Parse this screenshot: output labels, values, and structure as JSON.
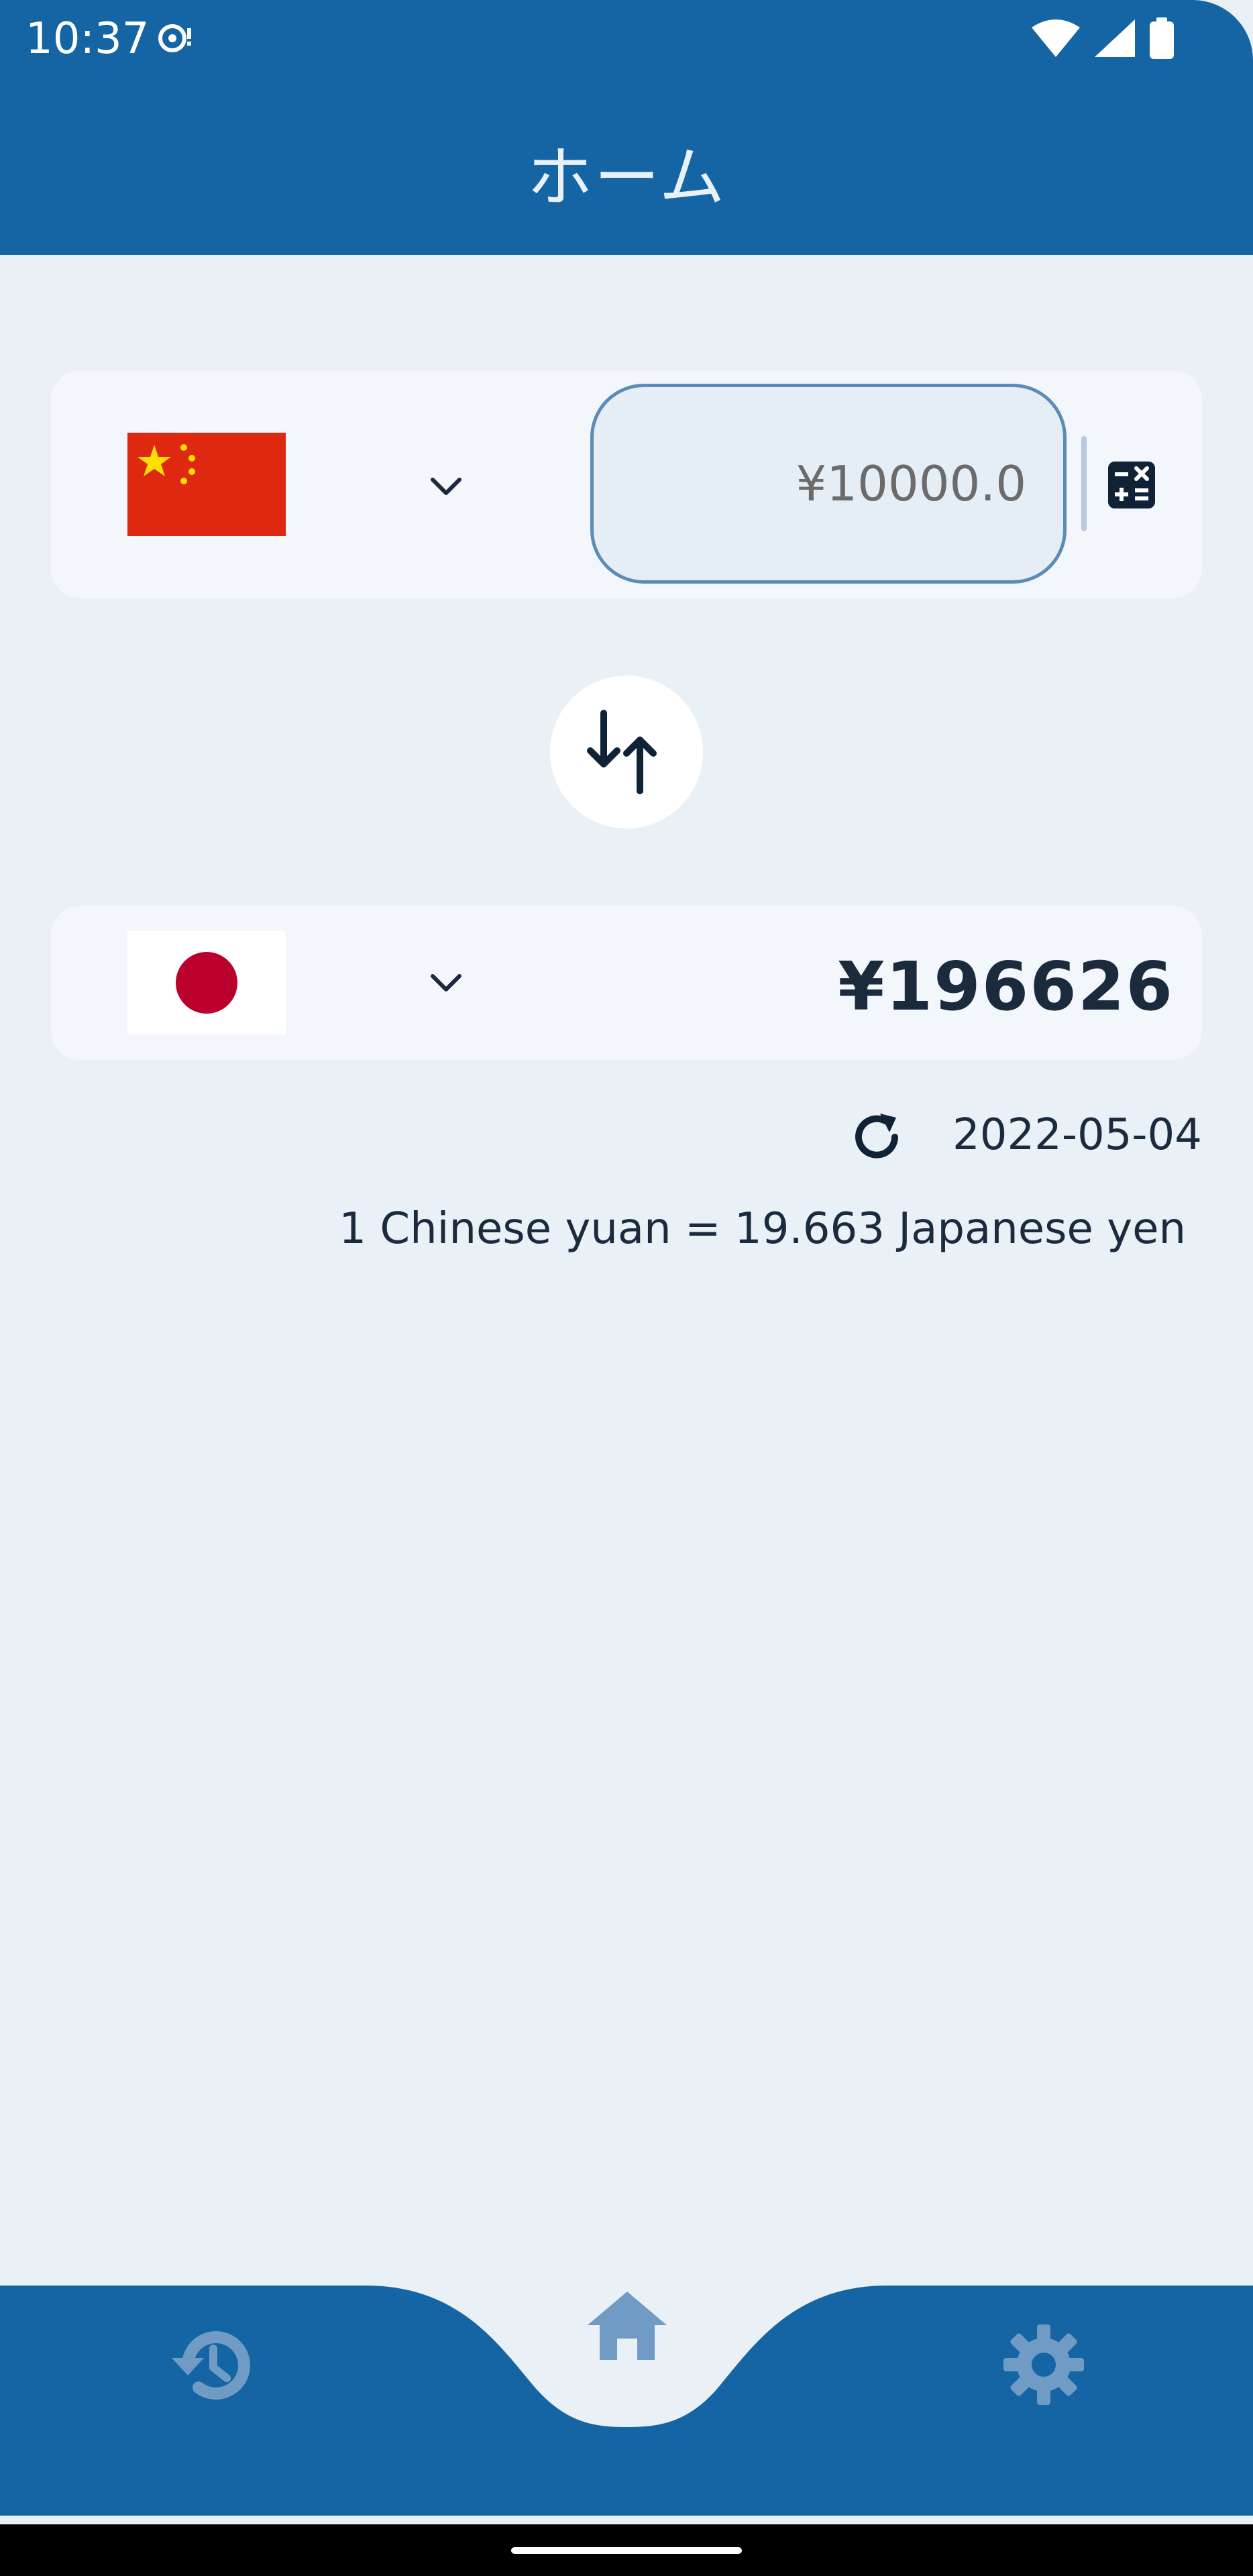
{
  "status_bar": {
    "time": "10:37"
  },
  "app_bar": {
    "title": "ホーム"
  },
  "converter": {
    "from": {
      "currency_flag": "china-flag",
      "amount_value": "¥10000.0"
    },
    "to": {
      "currency_flag": "japan-flag",
      "result_value": "¥196626"
    },
    "update_date": "2022-05-04",
    "rate_text": "1 Chinese yuan = 19.663 Japanese yen"
  },
  "bottom_nav": {
    "items": [
      {
        "icon": "history-icon",
        "active": false
      },
      {
        "icon": "home-icon",
        "active": true
      },
      {
        "icon": "gear-icon",
        "active": false
      }
    ]
  },
  "colors": {
    "primary": "#1565a4",
    "background": "#e9f0f6",
    "card": "#f3f7fb",
    "text": "#1b2a3d",
    "nav_icon": "#6f9bc4"
  }
}
